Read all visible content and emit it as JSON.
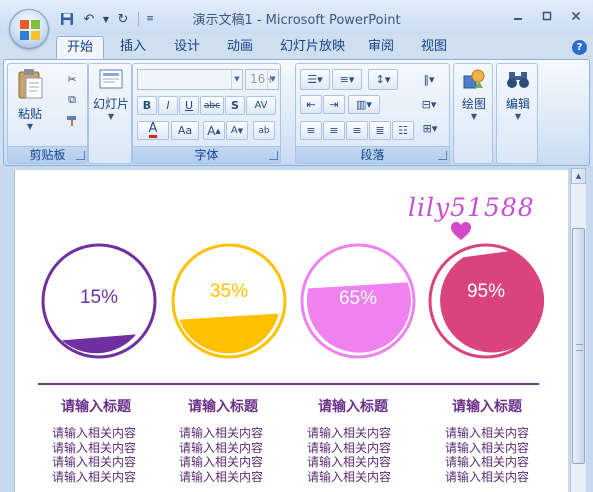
{
  "window": {
    "title": "演示文稿1 - Microsoft PowerPoint"
  },
  "tabs": [
    "开始",
    "插入",
    "设计",
    "动画",
    "幻灯片放映",
    "审阅",
    "视图"
  ],
  "active_tab": "开始",
  "ribbon": {
    "clipboard": {
      "paste_label": "粘贴",
      "group_label": "剪贴板"
    },
    "slides": {
      "slides_label": "幻灯片"
    },
    "font": {
      "size_value": "16+",
      "group_label": "字体"
    },
    "paragraph": {
      "group_label": "段落"
    },
    "drawing": {
      "label": "绘图"
    },
    "editing": {
      "label": "编辑"
    }
  },
  "slide": {
    "signature": "lily51588",
    "gauges": [
      {
        "label": "15%",
        "fill": 0.15,
        "color": "#7030a0",
        "text_color": "#7030a0"
      },
      {
        "label": "35%",
        "fill": 0.35,
        "color": "#ffc000",
        "text_color": "#ffc000"
      },
      {
        "label": "65%",
        "fill": 0.65,
        "color": "#ee82ee",
        "text_color": "#ffffff"
      },
      {
        "label": "95%",
        "fill": 0.95,
        "color": "#d9447f",
        "text_color": "#ffffff"
      }
    ],
    "columns": [
      {
        "title": "请输入标题",
        "lines": [
          "请输入相关内容",
          "请输入相关内容",
          "请输入相关内容",
          "请输入相关内容"
        ]
      },
      {
        "title": "请输入标题",
        "lines": [
          "请输入相关内容",
          "请输入相关内容",
          "请输入相关内容",
          "请输入相关内容"
        ]
      },
      {
        "title": "请输入标题",
        "lines": [
          "请输入相关内容",
          "请输入相关内容",
          "请输入相关内容",
          "请输入相关内容"
        ]
      },
      {
        "title": "请输入标题",
        "lines": [
          "请输入相关内容",
          "请输入相关内容",
          "请输入相关内容",
          "请输入相关内容"
        ]
      }
    ]
  }
}
